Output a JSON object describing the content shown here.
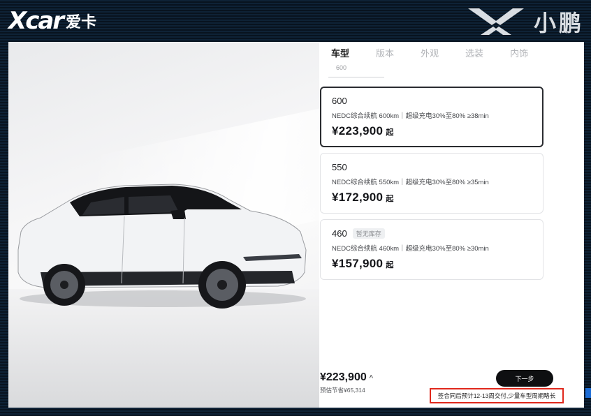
{
  "watermark": {
    "left_logo": "Xcar",
    "left_text": "爱卡",
    "right_text": "小鹏"
  },
  "tabs": [
    {
      "label": "车型",
      "active": true
    },
    {
      "label": "版本",
      "active": false
    },
    {
      "label": "外观",
      "active": false
    },
    {
      "label": "选装",
      "active": false
    },
    {
      "label": "内饰",
      "active": false
    }
  ],
  "active_tab_sub": "600",
  "trims": [
    {
      "name": "600",
      "badge": "",
      "spec": "NEDC综合续航 600km｜超级充电30%至80% ≥38min",
      "price": "¥223,900",
      "suffix": "起",
      "selected": true
    },
    {
      "name": "550",
      "badge": "",
      "spec": "NEDC综合续航 550km｜超级充电30%至80% ≥35min",
      "price": "¥172,900",
      "suffix": "起",
      "selected": false
    },
    {
      "name": "460",
      "badge": "暂无库存",
      "spec": "NEDC综合续航 460km｜超级充电30%至80% ≥30min",
      "price": "¥157,900",
      "suffix": "起",
      "selected": false
    }
  ],
  "summary": {
    "total": "¥223,900",
    "chevron": "^",
    "savings": "预估节省¥65,314"
  },
  "next_button": "下一步",
  "notice": "签合同后预计12-13周交付,少量车型周期略长",
  "colors": {
    "selected_border": "#2a2c30",
    "notice_border": "#e0281c",
    "button_bg": "#0e0f11"
  }
}
